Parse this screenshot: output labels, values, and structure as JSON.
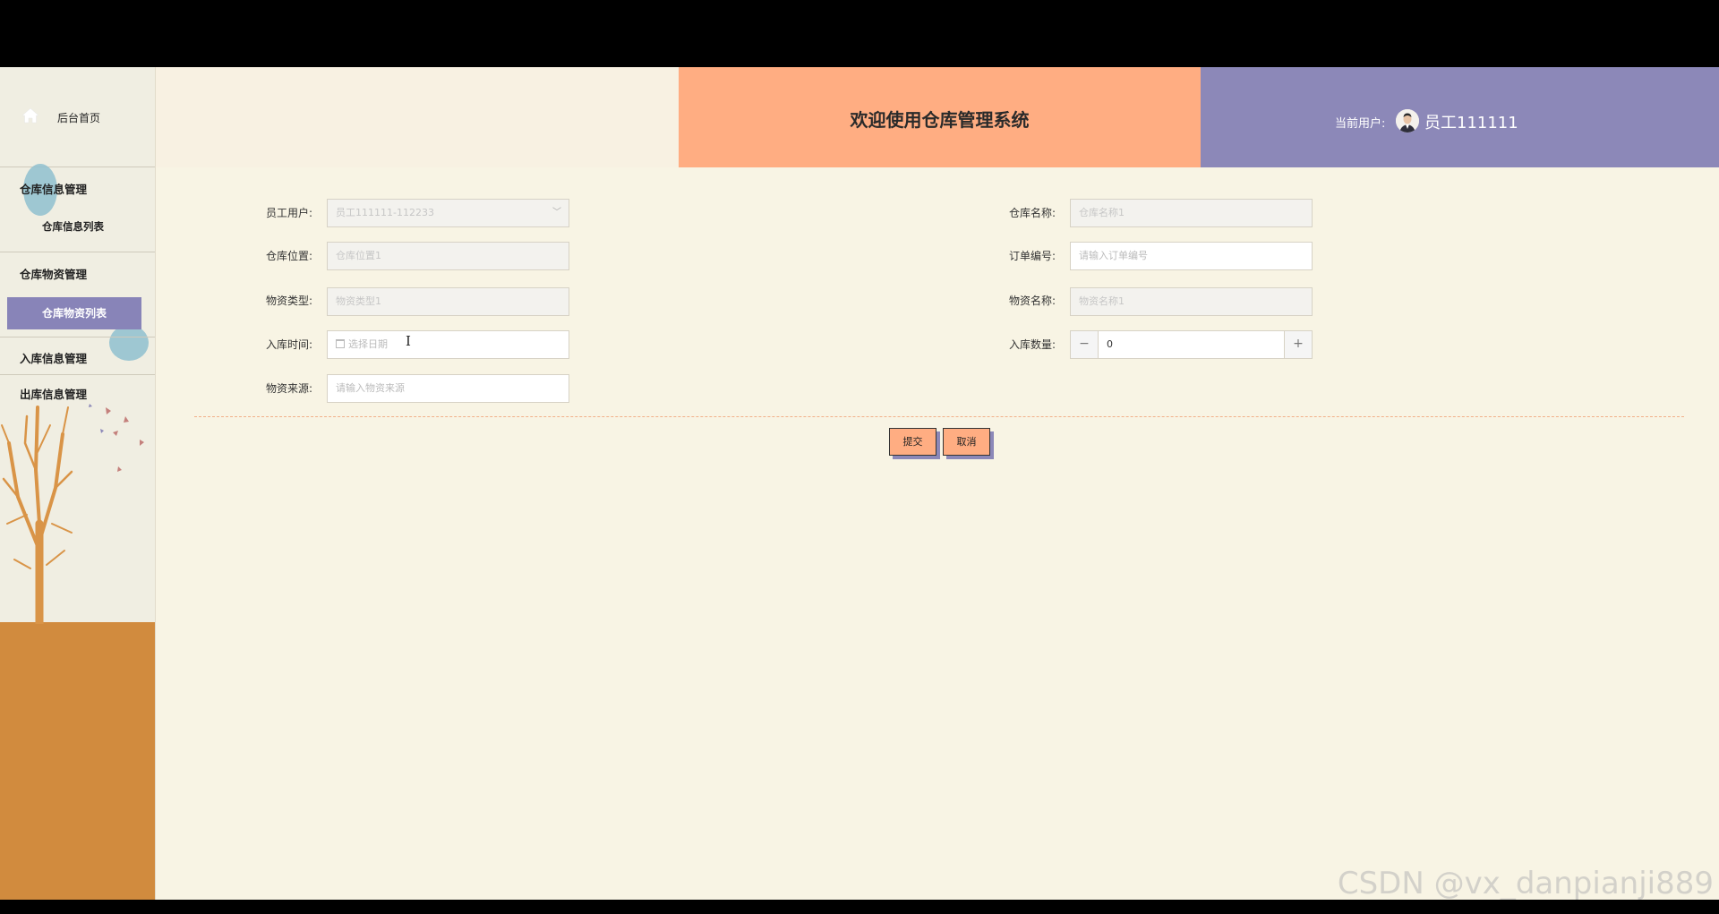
{
  "sidebar": {
    "home_label": "后台首页",
    "groups": [
      {
        "title": "仓库信息管理",
        "items": [
          "仓库信息列表"
        ]
      },
      {
        "title": "仓库物资管理",
        "items": [
          "仓库物资列表"
        ]
      },
      {
        "title": "入库信息管理",
        "items": []
      },
      {
        "title": "出库信息管理",
        "items": []
      }
    ],
    "active_item": "仓库物资列表"
  },
  "header": {
    "title": "欢迎使用仓库管理系统",
    "current_user_label": "当前用户:",
    "user_name": "员工111111"
  },
  "form": {
    "employee_user": {
      "label": "员工用户:",
      "value": "员工111111-112233"
    },
    "warehouse_name": {
      "label": "仓库名称:",
      "value": "仓库名称1"
    },
    "warehouse_location": {
      "label": "仓库位置:",
      "value": "仓库位置1"
    },
    "order_number": {
      "label": "订单编号:",
      "placeholder": "请输入订单编号"
    },
    "material_type": {
      "label": "物资类型:",
      "value": "物资类型1"
    },
    "material_name": {
      "label": "物资名称:",
      "value": "物资名称1"
    },
    "inbound_time": {
      "label": "入库时间:",
      "placeholder": "选择日期"
    },
    "inbound_quantity": {
      "label": "入库数量:",
      "value": "0",
      "minus": "−",
      "plus": "+"
    },
    "material_source": {
      "label": "物资来源:",
      "placeholder": "请输入物资来源"
    },
    "submit_label": "提交",
    "cancel_label": "取消"
  },
  "watermark": "CSDN @vx_danpianji889",
  "colors": {
    "accent_orange": "#ffad82",
    "accent_purple": "#8c88b8",
    "page_bg": "#f8f4e4",
    "ground": "#d18b3e"
  }
}
